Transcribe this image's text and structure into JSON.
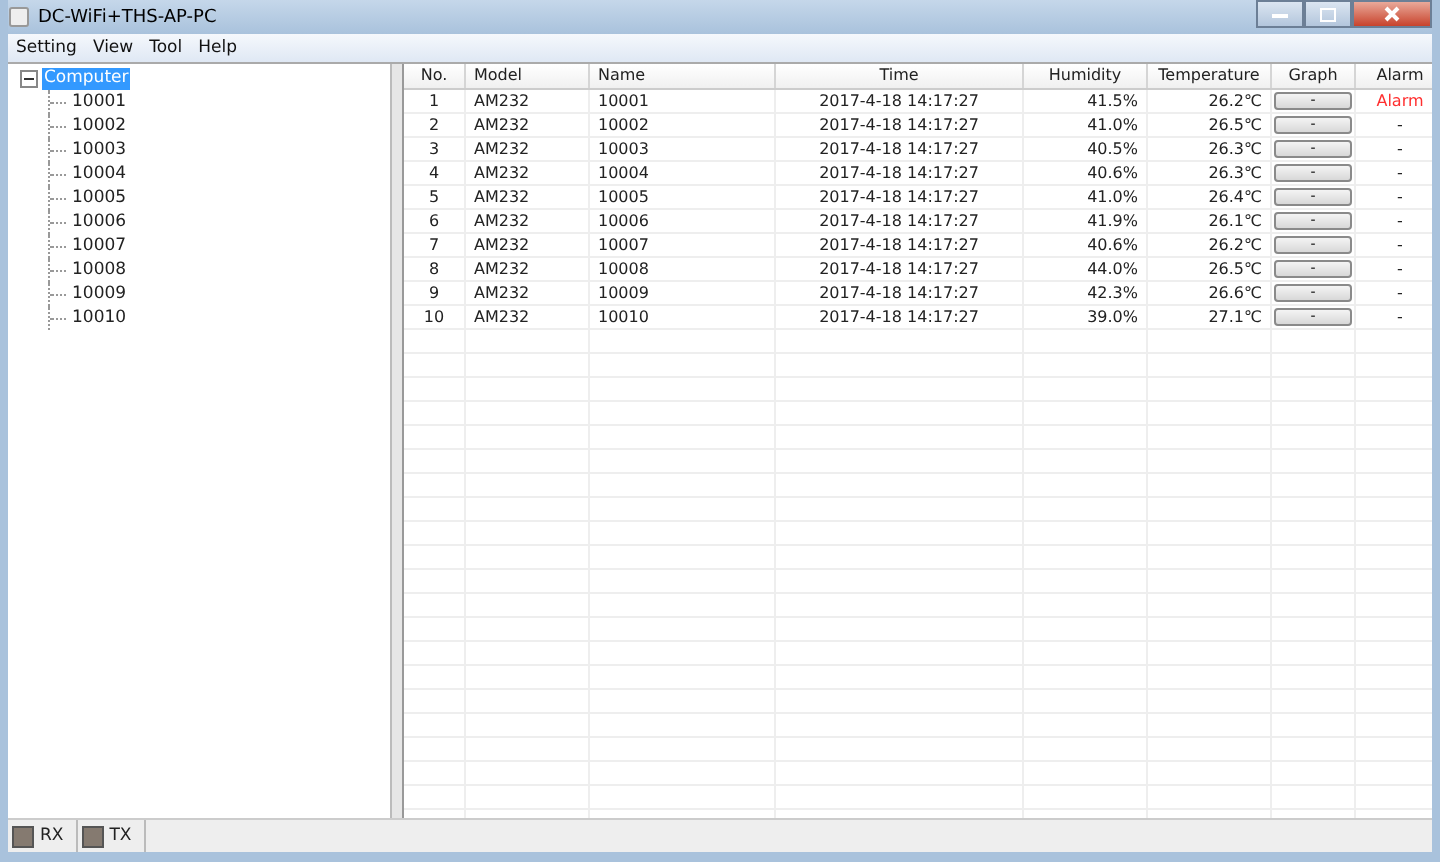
{
  "window": {
    "title": "DC-WiFi+THS-AP-PC"
  },
  "menu": [
    "Setting",
    "View",
    "Tool",
    "Help"
  ],
  "tree": {
    "label": "Computer",
    "expanded": true,
    "selected": true,
    "children": [
      {
        "label": "10001",
        "selected": false
      },
      {
        "label": "10002",
        "selected": false
      },
      {
        "label": "10003",
        "selected": false
      },
      {
        "label": "10004",
        "selected": false
      },
      {
        "label": "10005",
        "selected": false
      },
      {
        "label": "10006",
        "selected": false
      },
      {
        "label": "10007",
        "selected": false
      },
      {
        "label": "10008",
        "selected": false
      },
      {
        "label": "10009",
        "selected": false
      },
      {
        "label": "10010",
        "selected": false
      }
    ]
  },
  "table": {
    "columns": [
      "No.",
      "Model",
      "Name",
      "Time",
      "Humidity",
      "Temperature",
      "Graph",
      "Alarm"
    ],
    "rows": [
      {
        "no": "1",
        "model": "AM232",
        "name": "10001",
        "time": "2017-4-18 14:17:27",
        "humidity": "41.5%",
        "temperature": "26.2℃",
        "graph": "-",
        "alarm": "Alarm",
        "alarm_on": true
      },
      {
        "no": "2",
        "model": "AM232",
        "name": "10002",
        "time": "2017-4-18 14:17:27",
        "humidity": "41.0%",
        "temperature": "26.5℃",
        "graph": "-",
        "alarm": "-",
        "alarm_on": false
      },
      {
        "no": "3",
        "model": "AM232",
        "name": "10003",
        "time": "2017-4-18 14:17:27",
        "humidity": "40.5%",
        "temperature": "26.3℃",
        "graph": "-",
        "alarm": "-",
        "alarm_on": false
      },
      {
        "no": "4",
        "model": "AM232",
        "name": "10004",
        "time": "2017-4-18 14:17:27",
        "humidity": "40.6%",
        "temperature": "26.3℃",
        "graph": "-",
        "alarm": "-",
        "alarm_on": false
      },
      {
        "no": "5",
        "model": "AM232",
        "name": "10005",
        "time": "2017-4-18 14:17:27",
        "humidity": "41.0%",
        "temperature": "26.4℃",
        "graph": "-",
        "alarm": "-",
        "alarm_on": false
      },
      {
        "no": "6",
        "model": "AM232",
        "name": "10006",
        "time": "2017-4-18 14:17:27",
        "humidity": "41.9%",
        "temperature": "26.1℃",
        "graph": "-",
        "alarm": "-",
        "alarm_on": false
      },
      {
        "no": "7",
        "model": "AM232",
        "name": "10007",
        "time": "2017-4-18 14:17:27",
        "humidity": "40.6%",
        "temperature": "26.2℃",
        "graph": "-",
        "alarm": "-",
        "alarm_on": false
      },
      {
        "no": "8",
        "model": "AM232",
        "name": "10008",
        "time": "2017-4-18 14:17:27",
        "humidity": "44.0%",
        "temperature": "26.5℃",
        "graph": "-",
        "alarm": "-",
        "alarm_on": false
      },
      {
        "no": "9",
        "model": "AM232",
        "name": "10009",
        "time": "2017-4-18 14:17:27",
        "humidity": "42.3%",
        "temperature": "26.6℃",
        "graph": "-",
        "alarm": "-",
        "alarm_on": false
      },
      {
        "no": "10",
        "model": "AM232",
        "name": "10010",
        "time": "2017-4-18 14:17:27",
        "humidity": "39.0%",
        "temperature": "27.1℃",
        "graph": "-",
        "alarm": "-",
        "alarm_on": false
      }
    ]
  },
  "status_bar": [
    {
      "label": "RX"
    },
    {
      "label": "TX"
    }
  ]
}
